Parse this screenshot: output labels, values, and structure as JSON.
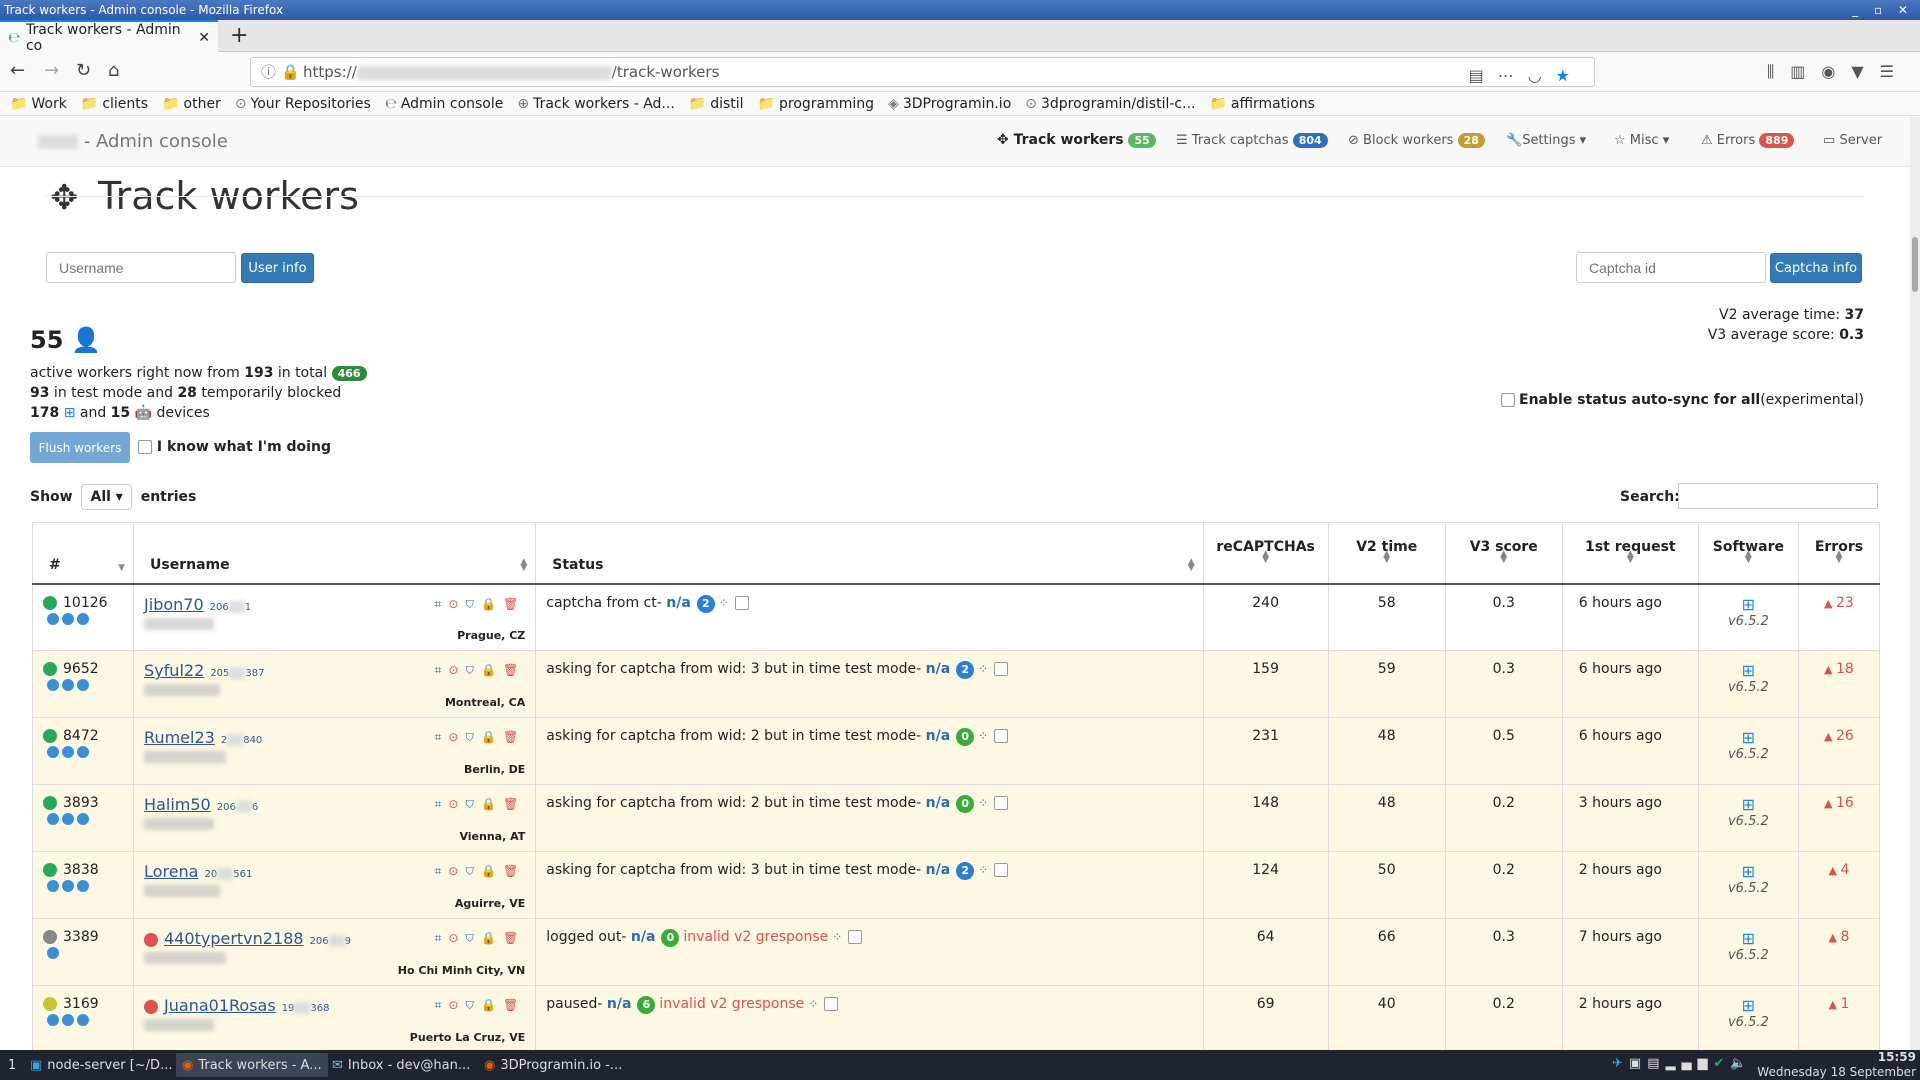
{
  "window": {
    "title": "Track workers - Admin console - Mozilla Firefox"
  },
  "browser": {
    "tab_title": "Track workers - Admin co",
    "url_prefix": "https://",
    "url_suffix": "/track-workers",
    "bookmarks": [
      "Work",
      "clients",
      "other",
      "Your Repositories",
      "Admin console",
      "Track workers - Ad...",
      "distil",
      "programming",
      "3DProgramin.io",
      "3dprogramin/distil-c...",
      "affirmations"
    ]
  },
  "nav": {
    "brand": "- Admin console",
    "track_workers": "Track workers",
    "track_workers_count": "55",
    "track_captchas": "Track captchas",
    "track_captchas_count": "804",
    "block_workers": "Block workers",
    "block_workers_count": "28",
    "settings": "Settings",
    "misc": "Misc",
    "errors": "Errors",
    "errors_count": "889",
    "server": "Server"
  },
  "page": {
    "title": "Track workers",
    "username_placeholder": "Username",
    "user_info_btn": "User info",
    "captcha_placeholder": "Captcha id",
    "captcha_info_btn": "Captcha info",
    "active_count": "55",
    "line1_a": "active workers right now from ",
    "line1_b": "193",
    "line1_c": " in total ",
    "line1_badge": "466",
    "line2_a": "93",
    "line2_b": " in test mode and ",
    "line2_c": "28",
    "line2_d": " temporarily blocked",
    "line3_a": "178",
    "line3_b": "and",
    "line3_c": "15",
    "line3_d": "devices",
    "v2_label": "V2 average time: ",
    "v2_value": "37",
    "v3_label": "V3 average score: ",
    "v3_value": "0.3",
    "autosync_label": "Enable status auto-sync for all",
    "autosync_note": "(experimental)",
    "flush_btn": "Flush workers",
    "know_label": "I know what I'm doing",
    "show": "Show",
    "show_value": "All",
    "entries": "entries",
    "search_label": "Search:"
  },
  "table": {
    "headers": [
      "#",
      "Username",
      "Status",
      "reCAPTCHAs",
      "V2 time",
      "V3 score",
      "1st request",
      "Software",
      "Errors"
    ],
    "rows": [
      {
        "id": "10126",
        "dot": "green",
        "minis": 3,
        "user": "Jibon70",
        "wid": "206",
        "wid2": "1",
        "loc": "Prague, CZ",
        "status_pre": "captcha from ct- ",
        "na": "n/a",
        "badge": "2",
        "badge_color": "blue",
        "status_post": "",
        "recaptchas": "240",
        "v2": "58",
        "v3": "0.3",
        "first": "6 hours ago",
        "ver": "v6.5.2",
        "errors": "23",
        "userdot": ""
      },
      {
        "id": "9652",
        "dot": "green",
        "minis": 3,
        "user": "Syful22",
        "wid": "205",
        "wid2": "387",
        "loc": "Montreal, CA",
        "status_pre": "asking for captcha from wid: 3 but in time test mode- ",
        "na": "n/a",
        "badge": "2",
        "badge_color": "blue",
        "status_post": "",
        "recaptchas": "159",
        "v2": "59",
        "v3": "0.3",
        "first": "6 hours ago",
        "ver": "v6.5.2",
        "errors": "18",
        "userdot": ""
      },
      {
        "id": "8472",
        "dot": "green",
        "minis": 3,
        "user": "Rumel23",
        "wid": "2",
        "wid2": "840",
        "loc": "Berlin, DE",
        "status_pre": "asking for captcha from wid: 2 but in time test mode- ",
        "na": "n/a",
        "badge": "0",
        "badge_color": "green",
        "status_post": "",
        "recaptchas": "231",
        "v2": "48",
        "v3": "0.5",
        "first": "6 hours ago",
        "ver": "v6.5.2",
        "errors": "26",
        "userdot": ""
      },
      {
        "id": "3893",
        "dot": "green",
        "minis": 3,
        "user": "Halim50",
        "wid": "206",
        "wid2": "6",
        "loc": "Vienna, AT",
        "status_pre": "asking for captcha from wid: 2 but in time test mode- ",
        "na": "n/a",
        "badge": "0",
        "badge_color": "green",
        "status_post": "",
        "recaptchas": "148",
        "v2": "48",
        "v3": "0.2",
        "first": "3 hours ago",
        "ver": "v6.5.2",
        "errors": "16",
        "userdot": ""
      },
      {
        "id": "3838",
        "dot": "green",
        "minis": 3,
        "user": "Lorena",
        "wid": "20",
        "wid2": "561",
        "loc": "Aguirre, VE",
        "status_pre": "asking for captcha from wid: 3 but in time test mode- ",
        "na": "n/a",
        "badge": "2",
        "badge_color": "blue",
        "status_post": "",
        "recaptchas": "124",
        "v2": "50",
        "v3": "0.2",
        "first": "2 hours ago",
        "ver": "v6.5.2",
        "errors": "4",
        "userdot": ""
      },
      {
        "id": "3389",
        "dot": "grey",
        "minis": 1,
        "user": "440typertvn2188",
        "wid": "206",
        "wid2": "9",
        "loc": "Ho Chi Minh City, VN",
        "status_pre": "logged out- ",
        "na": "n/a",
        "badge": "0",
        "badge_color": "green",
        "status_post": "invalid v2 gresponse",
        "recaptchas": "64",
        "v2": "66",
        "v3": "0.3",
        "first": "7 hours ago",
        "ver": "v6.5.2",
        "errors": "8",
        "userdot": "red"
      },
      {
        "id": "3169",
        "dot": "yellow",
        "minis": 3,
        "user": "Juana01Rosas",
        "wid": "19",
        "wid2": "368",
        "loc": "Puerto La Cruz, VE",
        "status_pre": "paused- ",
        "na": "n/a",
        "badge": "6",
        "badge_color": "green",
        "status_post": "invalid v2 gresponse",
        "recaptchas": "69",
        "v2": "40",
        "v3": "0.2",
        "first": "2 hours ago",
        "ver": "v6.5.2",
        "errors": "1",
        "userdot": "red"
      }
    ]
  },
  "taskbar": {
    "workspace": "1",
    "items": [
      "node-server [~/D...",
      "Track workers - A...",
      "Inbox - dev@han...",
      "3DProgramin.io -..."
    ],
    "time": "15:59",
    "date": "Wednesday 18 September"
  }
}
